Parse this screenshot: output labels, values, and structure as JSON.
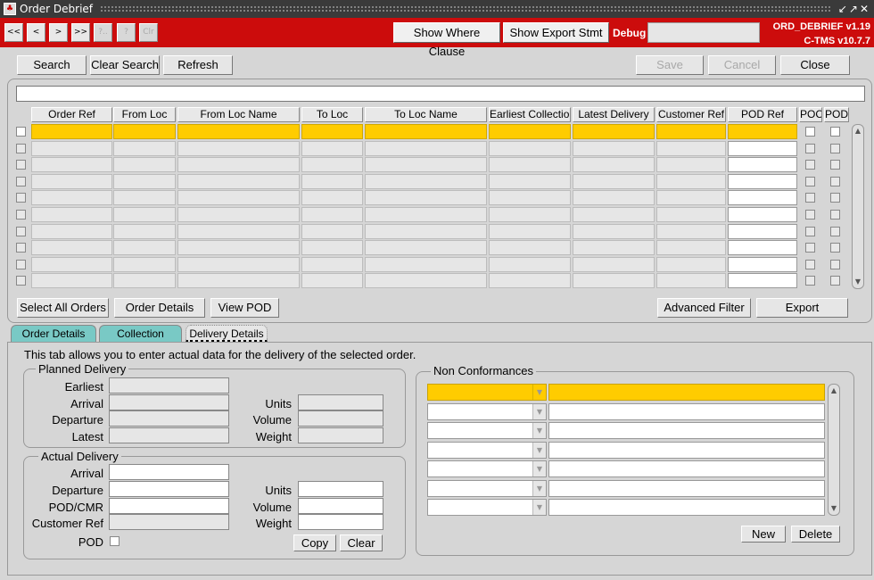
{
  "window": {
    "title": "Order Debrief"
  },
  "toolbar": {
    "nav": [
      "<<",
      "<",
      ">",
      ">>",
      "?..",
      "?",
      "Clr"
    ],
    "show_where": "Show Where Clause",
    "show_export": "Show Export Stmt",
    "debug_label": "Debug",
    "debug_value": "",
    "form_name": "ORD_DEBRIEF v1.19",
    "app_version": "C-TMS v10.7.7"
  },
  "actions": {
    "search": "Search",
    "clear_search": "Clear Search",
    "refresh": "Refresh",
    "save": "Save",
    "cancel": "Cancel",
    "close": "Close"
  },
  "grid": {
    "filter_value": "",
    "columns": [
      "Order Ref",
      "From Loc",
      "From Loc Name",
      "To Loc",
      "To Loc Name",
      "Earliest Collection",
      "Latest Delivery",
      "Customer Ref",
      "POD Ref",
      "POC",
      "POD"
    ],
    "row_count": 10
  },
  "grid_buttons": {
    "select_all": "Select All Orders",
    "order_details": "Order Details",
    "view_pod": "View POD",
    "advanced_filter": "Advanced Filter",
    "export": "Export"
  },
  "tabs": [
    {
      "label": "Order Details"
    },
    {
      "label": "Collection Details"
    },
    {
      "label": "Delivery Details"
    }
  ],
  "delivery": {
    "description": "This tab allows you to enter actual data for the delivery of the selected order.",
    "planned": {
      "title": "Planned Delivery",
      "earliest": "Earliest",
      "arrival": "Arrival",
      "departure": "Departure",
      "latest": "Latest",
      "units": "Units",
      "volume": "Volume",
      "weight": "Weight"
    },
    "actual": {
      "title": "Actual Delivery",
      "arrival": "Arrival",
      "departure": "Departure",
      "pod_cmr": "POD/CMR",
      "customer_ref": "Customer Ref",
      "pod": "POD",
      "units": "Units",
      "volume": "Volume",
      "weight": "Weight",
      "copy": "Copy",
      "clear": "Clear"
    }
  },
  "non_conformances": {
    "title": "Non Conformances",
    "row_count": 7,
    "new": "New",
    "delete": "Delete"
  },
  "colors": {
    "toolbar": "#cc0c0c",
    "selected_row": "#ffcc00",
    "active_tab": "#79c9c5"
  }
}
